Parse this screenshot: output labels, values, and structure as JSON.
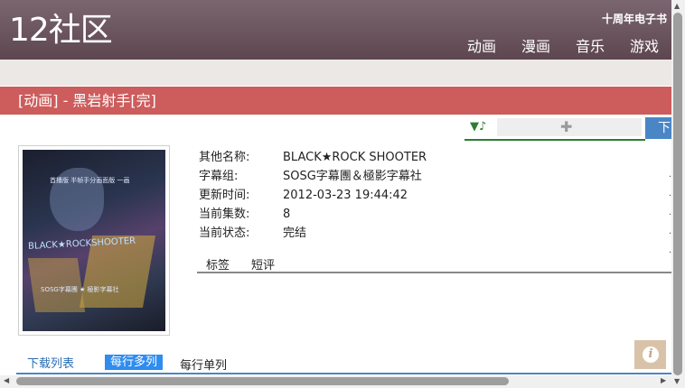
{
  "header": {
    "logo": "12社区",
    "top_link": "十周年电子书",
    "nav": [
      "动画",
      "漫画",
      "音乐",
      "游戏"
    ]
  },
  "title_bar": {
    "title": "[动画] - 黑岩射手[完]"
  },
  "toolbar": {
    "music_icon": "music-note-icon",
    "puzzle_icon": "puzzle-icon",
    "download_label": "下"
  },
  "info": {
    "rows": [
      {
        "label": "其他名称:",
        "value": "BLACK★ROCK SHOOTER"
      },
      {
        "label": "字幕组:",
        "value": "SOSG字幕團＆極影字幕社"
      },
      {
        "label": "更新时间:",
        "value": "2012-03-23 19:44:42"
      },
      {
        "label": "当前集数:",
        "value": "8"
      },
      {
        "label": "当前状态:",
        "value": "完结"
      }
    ]
  },
  "tabs": [
    "标签",
    "短评"
  ],
  "download_list": {
    "title": "下载列表",
    "option_multi": "每行多列",
    "option_single": "每行单列"
  },
  "cover": {
    "title_text": "BLACK★ROCKSHOOTER",
    "sub_text": "SOSG字幕團 ★ 極影字幕社",
    "side_text": "首播版 半帧手分画面版 一画"
  },
  "colors": {
    "header": "#6b5560",
    "title_bar": "#cd5c5c",
    "accent_blue": "#4a86c5",
    "toggle_blue": "#2f8cf0",
    "music_green": "#2e7d32"
  }
}
